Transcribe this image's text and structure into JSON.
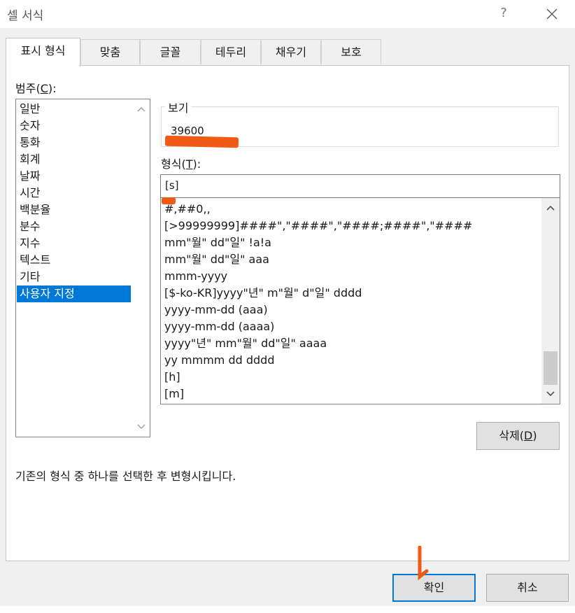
{
  "window": {
    "title": "셀 서식",
    "help": "?"
  },
  "tabs": [
    {
      "label": "표시 형식",
      "active": true
    },
    {
      "label": "맞춤"
    },
    {
      "label": "글꼴"
    },
    {
      "label": "테두리"
    },
    {
      "label": "채우기"
    },
    {
      "label": "보호"
    }
  ],
  "category": {
    "label_pre": "범주(",
    "label_key": "C",
    "label_post": "):",
    "items": [
      "일반",
      "숫자",
      "통화",
      "회계",
      "날짜",
      "시간",
      "백분율",
      "분수",
      "지수",
      "텍스트",
      "기타",
      "사용자 지정"
    ],
    "selected": "사용자 지정"
  },
  "preview": {
    "legend": "보기",
    "value": "39600"
  },
  "format": {
    "label_pre": "형식(",
    "label_key": "T",
    "label_post": "):",
    "input_value": "[s]",
    "list": [
      "#,##0,,",
      "[>99999999]####\",\"####\",\"####;####\",\"####",
      "mm\"월\" dd\"일\" !a!a",
      "mm\"월\" dd\"일\" aaa",
      "mmm-yyyy",
      "[$-ko-KR]yyyy\"년\" m\"월\" d\"일\" dddd",
      "yyyy-mm-dd (aaa)",
      "yyyy-mm-dd (aaaa)",
      "yyyy\"년\" mm\"월\" dd\"일\" aaaa",
      "yy mmmm dd dddd",
      "[h]",
      "[m]"
    ]
  },
  "delete_button": {
    "pre": "삭제(",
    "key": "D",
    "post": ")"
  },
  "description": "기존의 형식 중 하나를 선택한 후 변형시킵니다.",
  "buttons": {
    "ok": "확인",
    "cancel": "취소"
  },
  "colors": {
    "accent": "#0078d7",
    "annotation": "#f05a14"
  }
}
